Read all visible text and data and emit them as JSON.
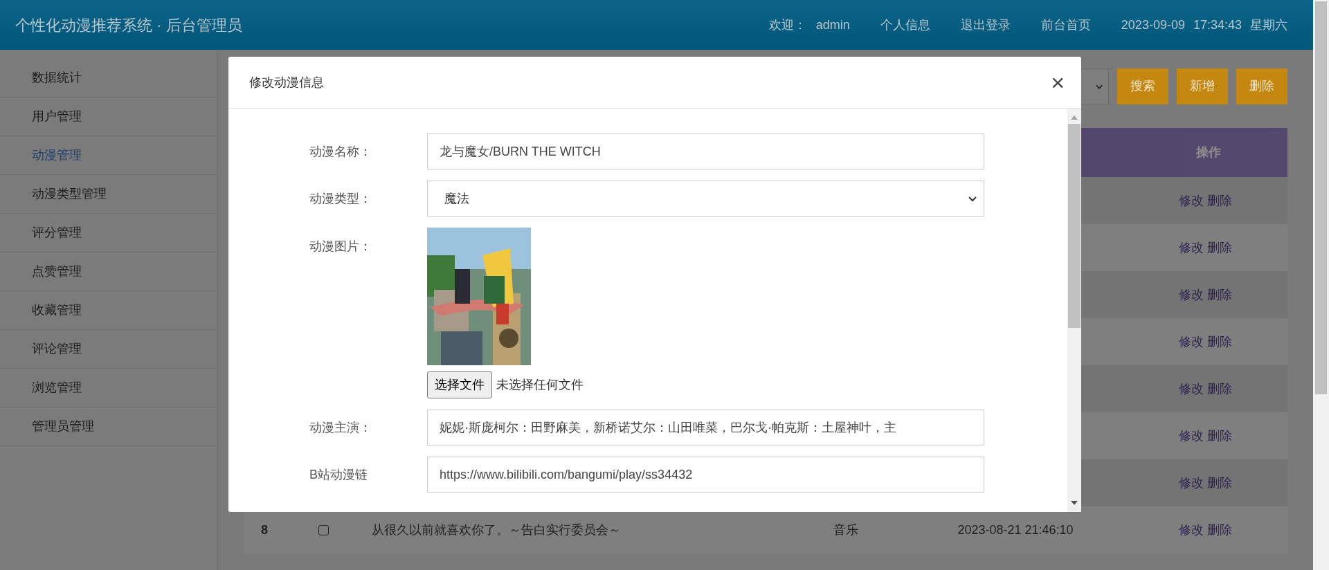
{
  "header": {
    "title": "个性化动漫推荐系统 · 后台管理员",
    "welcome_label": "欢迎：",
    "username": "admin",
    "nav": [
      "个人信息",
      "退出登录",
      "前台首页"
    ],
    "date": "2023-09-09",
    "time": "17:34:43",
    "weekday": "星期六"
  },
  "sidebar": {
    "items": [
      {
        "label": "数据统计",
        "selected": false
      },
      {
        "label": "用户管理",
        "selected": false
      },
      {
        "label": "动漫管理",
        "selected": true
      },
      {
        "label": "动漫类型管理",
        "selected": false
      },
      {
        "label": "评分管理",
        "selected": false
      },
      {
        "label": "点赞管理",
        "selected": false
      },
      {
        "label": "收藏管理",
        "selected": false
      },
      {
        "label": "评论管理",
        "selected": false
      },
      {
        "label": "浏览管理",
        "selected": false
      },
      {
        "label": "管理员管理",
        "selected": false
      }
    ]
  },
  "toolbar": {
    "buttons": [
      "搜索",
      "新增",
      "删除"
    ]
  },
  "table": {
    "columns": [
      {
        "label": "操作"
      }
    ],
    "rows": [
      {
        "actions": [
          "修改",
          "删除"
        ]
      },
      {
        "actions": [
          "修改",
          "删除"
        ]
      },
      {
        "actions": [
          "修改",
          "删除"
        ]
      },
      {
        "actions": [
          "修改",
          "删除"
        ]
      },
      {
        "actions": [
          "修改",
          "删除"
        ]
      },
      {
        "actions": [
          "修改",
          "删除"
        ]
      },
      {
        "actions": [
          "修改",
          "删除"
        ]
      },
      {
        "number": "8",
        "checked": false,
        "title": "从很久以前就喜欢你了。～告白实行委员会～",
        "type": "音乐",
        "time": "2023-08-21 21:46:10",
        "actions": [
          "修改",
          "删除"
        ]
      }
    ]
  },
  "dialog": {
    "title": "修改动漫信息",
    "close": "×",
    "fields": [
      {
        "kind": "text",
        "label": "动漫名称：",
        "value": "龙与魔女/BURN THE WITCH"
      },
      {
        "kind": "select",
        "label": "动漫类型：",
        "value": "魔法"
      },
      {
        "label": "动漫图片：",
        "button": "选择文件",
        "status": "未选择任何文件"
      },
      {
        "kind": "text",
        "label": "动漫主演：",
        "value": "妮妮·斯庞柯尔：田野麻美，新桥诺艾尔：山田唯菜，巴尔戈·帕克斯：土屋神叶，主"
      },
      {
        "kind": "text",
        "label": "B站动漫链",
        "value": "https://www.bilibili.com/bangumi/play/ss34432"
      }
    ]
  }
}
